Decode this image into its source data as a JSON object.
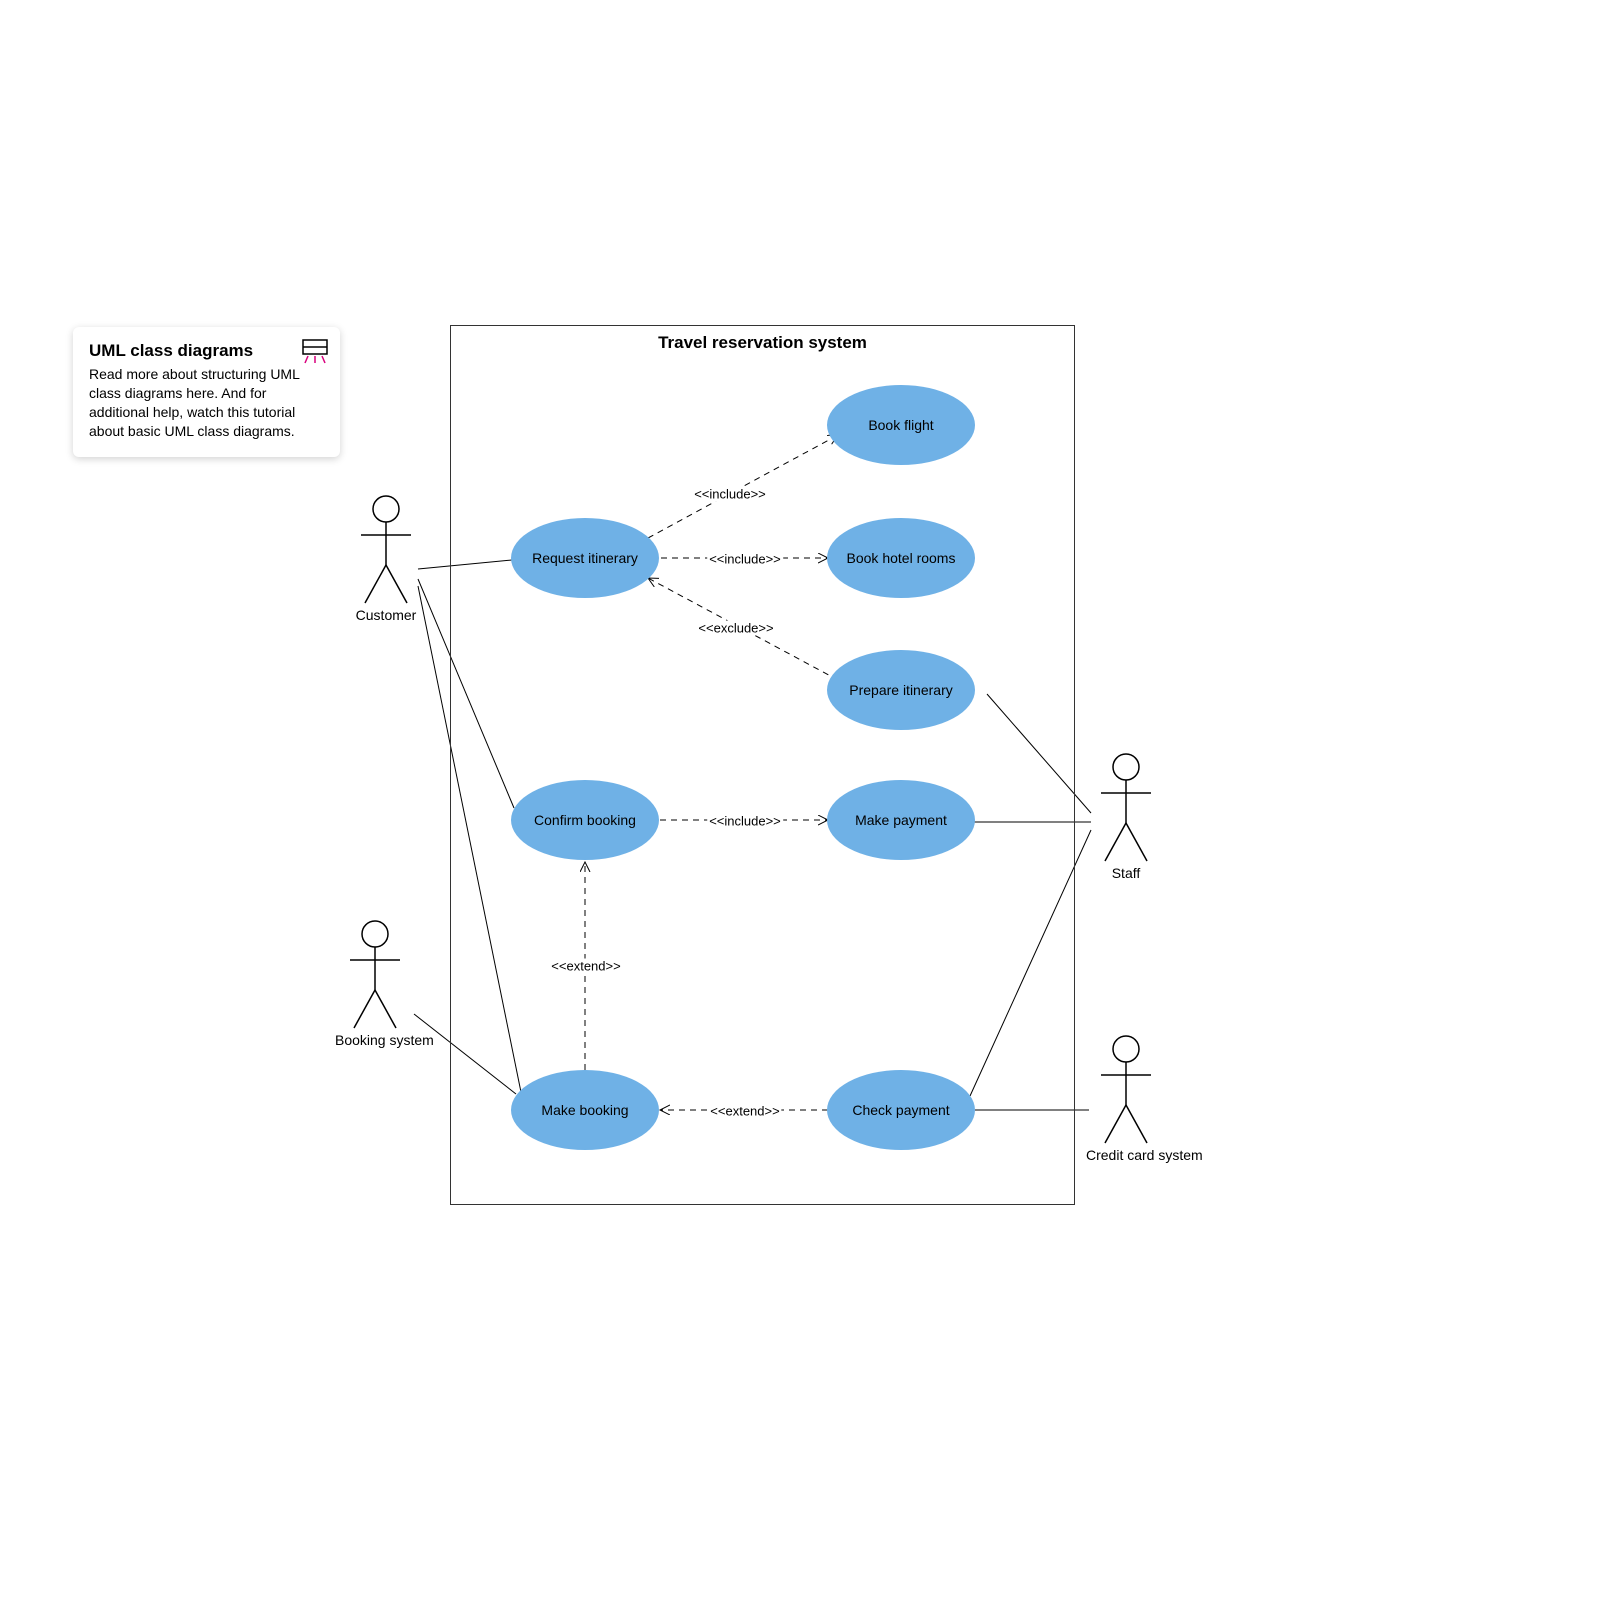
{
  "tip": {
    "title": "UML class diagrams",
    "body": "Read more about structuring UML class diagrams here. And for additional help, watch this tutorial about basic UML class diagrams."
  },
  "system_title": "Travel reservation system",
  "usecases": {
    "request_itinerary": "Request itinerary",
    "book_flight": "Book flight",
    "book_hotel_rooms": "Book hotel rooms",
    "prepare_itinerary": "Prepare itinerary",
    "confirm_booking": "Confirm booking",
    "make_payment": "Make payment",
    "make_booking": "Make booking",
    "check_payment": "Check payment"
  },
  "actors": {
    "customer": "Customer",
    "booking_system": "Booking system",
    "staff": "Staff",
    "credit_card_system": "Credit card system"
  },
  "rel": {
    "include": "<<include>>",
    "exclude": "<<exclude>>",
    "extend": "<<extend>>"
  }
}
